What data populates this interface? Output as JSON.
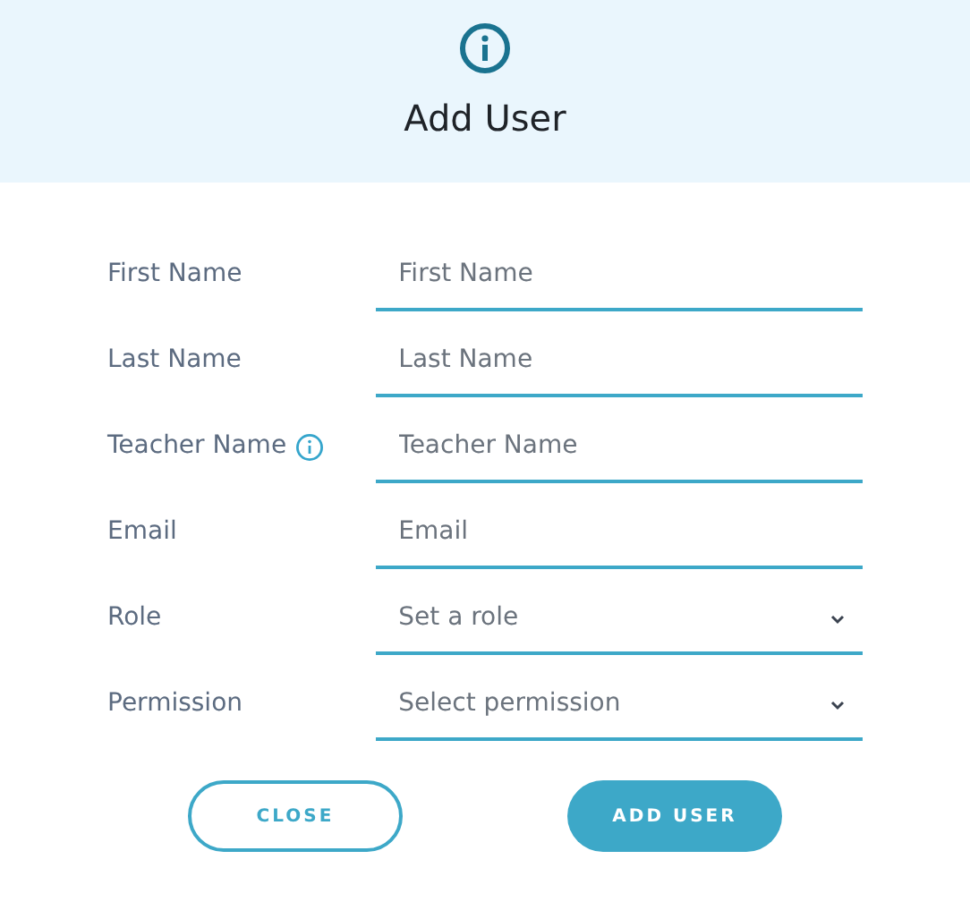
{
  "dialog": {
    "title": "Add User"
  },
  "fields": [
    {
      "label": "First Name",
      "kind": "text",
      "placeholder": "First Name",
      "info": false
    },
    {
      "label": "Last Name",
      "kind": "text",
      "placeholder": "Last Name",
      "info": false
    },
    {
      "label": "Teacher Name",
      "kind": "text",
      "placeholder": "Teacher Name",
      "info": true
    },
    {
      "label": "Email",
      "kind": "text",
      "placeholder": "Email",
      "info": false
    },
    {
      "label": "Role",
      "kind": "select",
      "placeholder": "Set a role",
      "info": false
    },
    {
      "label": "Permission",
      "kind": "select",
      "placeholder": "Select permission",
      "info": false
    }
  ],
  "buttons": [
    {
      "label": "CLOSE",
      "kind": "secondary"
    },
    {
      "label": "ADD USER",
      "kind": "primary"
    }
  ]
}
